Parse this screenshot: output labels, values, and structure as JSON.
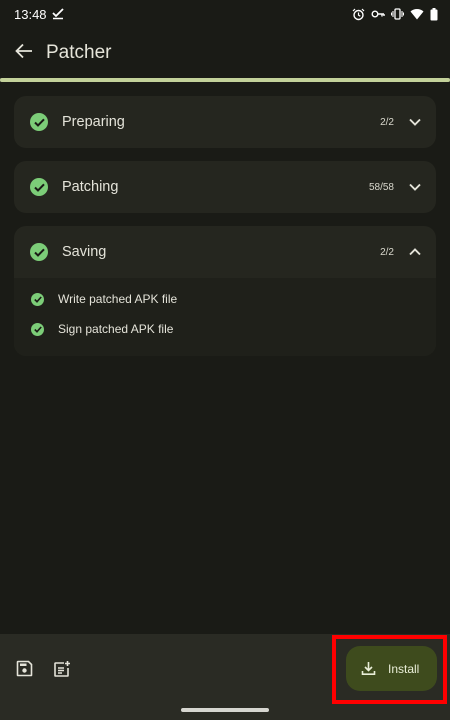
{
  "status_bar": {
    "time": "13:48",
    "icons": [
      "check-download-icon",
      "alarm-icon",
      "vpn-key-icon",
      "vibrate-icon",
      "wifi-icon",
      "battery-icon"
    ]
  },
  "app_bar": {
    "title": "Patcher",
    "back_icon": "arrow-back-icon"
  },
  "progress": {
    "fraction": 1.0,
    "color": "#c3d19a"
  },
  "steps": [
    {
      "title": "Preparing",
      "count": "2/2",
      "expanded": false,
      "status": "done"
    },
    {
      "title": "Patching",
      "count": "58/58",
      "expanded": false,
      "status": "done"
    },
    {
      "title": "Saving",
      "count": "2/2",
      "expanded": true,
      "status": "done",
      "items": [
        {
          "label": "Write patched APK file",
          "status": "done"
        },
        {
          "label": "Sign patched APK file",
          "status": "done"
        }
      ]
    }
  ],
  "bottom_bar": {
    "save_icon": "save-icon",
    "log_icon": "post-add-icon",
    "install_label": "Install",
    "install_icon": "download-icon"
  },
  "colors": {
    "background": "#1a1b16",
    "card": "#25261f",
    "check": "#7ccd78",
    "install_button": "#3e4b1d",
    "highlight": "#ff0000"
  }
}
